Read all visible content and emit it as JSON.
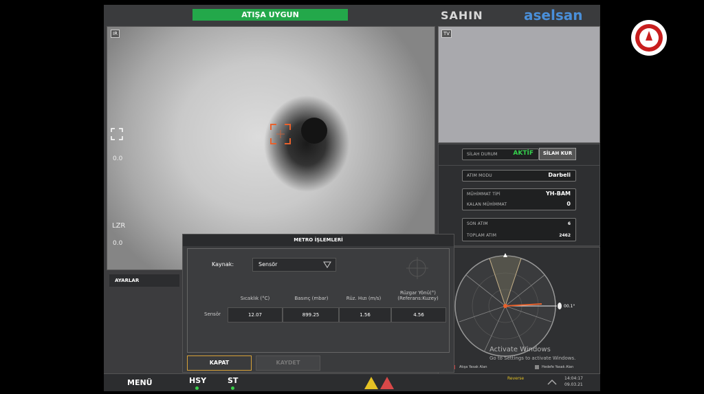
{
  "header": {
    "status": "ATIŞA UYGUN",
    "brand_left": "SAHIN",
    "brand_right": "aselsan"
  },
  "ir_view": {
    "tag": "IR",
    "side_top": "0.0",
    "side_label": "LZR",
    "side_bottom": "0.0"
  },
  "tv_view": {
    "tag": "TV"
  },
  "weapon": {
    "state_label": "SİLAH DURUM",
    "state_value": "AKTİF",
    "arm_button": "SİLAH KUR"
  },
  "fire": {
    "mode_label": "ATIM MODU",
    "mode_value": "Darbeli",
    "ammo_type_label": "MÜHİMMAT TİPİ",
    "ammo_type_value": "YH-BAM",
    "ammo_left_label": "KALAN MÜHİMMAT",
    "ammo_left_value": "0",
    "last_label": "SON ATIM",
    "last_value": "6",
    "total_label": "TOPLAM ATIM",
    "total_value": "2462"
  },
  "radar": {
    "angle_readout": "00.1°",
    "legend_left": "Atışa Yasak Alan",
    "legend_right": "Hedefe Yasak Alan",
    "activate_line1": "Activate Windows",
    "activate_line2": "Go to Settings to activate Windows."
  },
  "metro": {
    "title": "METRO İŞLEMLERİ",
    "source_label": "Kaynak:",
    "source_value": "Sensör",
    "columns": [
      "Sıcaklık (°C)",
      "Basınç (mbar)",
      "Rüz. Hızı (m/s)",
      "Rüzgar Yönü(°) (Referans:Kuzey)"
    ],
    "row_label": "Sensör",
    "values": [
      "12.07",
      "899.25",
      "1.56",
      "4.56"
    ],
    "close_button": "KAPAT",
    "save_button": "KAYDET"
  },
  "settings": {
    "label": "AYARLAR"
  },
  "bottom": {
    "menu": "MENÜ",
    "hsy": "HSY",
    "st": "ST",
    "reserve": "Reverse",
    "time": "14:04:17",
    "date": "09.03.21"
  },
  "colors": {
    "status_green": "#23a84a",
    "brand_blue": "#4a8fd9",
    "active_green": "#35d14d",
    "warn_yellow": "#e5c224",
    "warn_red": "#d94848"
  }
}
